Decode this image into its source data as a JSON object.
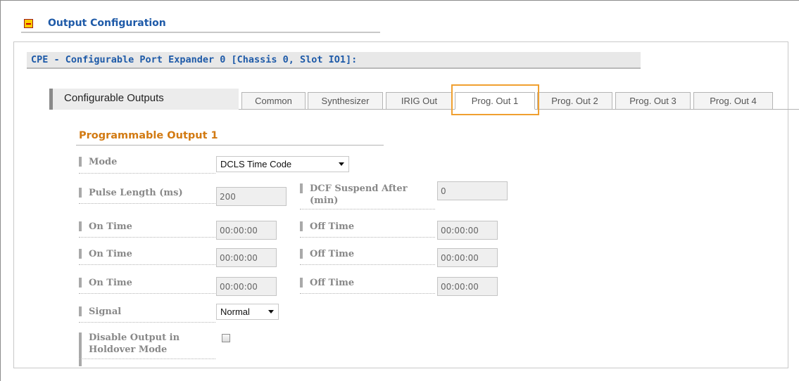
{
  "section": {
    "title": "Output Configuration"
  },
  "panel": {
    "title": "CPE - Configurable Port Expander 0 [Chassis 0, Slot IO1]:"
  },
  "tabs": {
    "heading": "Configurable Outputs",
    "items": [
      {
        "label": "Common"
      },
      {
        "label": "Synthesizer"
      },
      {
        "label": "IRIG Out"
      },
      {
        "label": "Prog. Out 1"
      },
      {
        "label": "Prog. Out 2"
      },
      {
        "label": "Prog. Out 3"
      },
      {
        "label": "Prog. Out 4"
      }
    ],
    "active": "Prog. Out 1"
  },
  "form": {
    "title": "Programmable Output 1",
    "mode": {
      "label": "Mode",
      "value": "DCLS Time Code"
    },
    "pulse_length": {
      "label": "Pulse Length (ms)",
      "value": "200"
    },
    "dcf_suspend": {
      "label_line1": "DCF Suspend After",
      "label_line2": "(min)",
      "value": "0"
    },
    "times": [
      {
        "on_label": "On Time",
        "on_value": "00:00:00",
        "off_label": "Off Time",
        "off_value": "00:00:00"
      },
      {
        "on_label": "On Time",
        "on_value": "00:00:00",
        "off_label": "Off Time",
        "off_value": "00:00:00"
      },
      {
        "on_label": "On Time",
        "on_value": "00:00:00",
        "off_label": "Off Time",
        "off_value": "00:00:00"
      }
    ],
    "signal": {
      "label": "Signal",
      "value": "Normal"
    },
    "disable_holdover": {
      "label_line1": "Disable Output in",
      "label_line2": "Holdover Mode",
      "checked": false
    }
  },
  "colors": {
    "title_blue": "#1e5aa8",
    "form_title_orange": "#d27a12",
    "active_tab_highlight": "#f0a030"
  },
  "icons": {
    "collapse": "minus-square-icon",
    "dropdown": "caret-down-icon"
  }
}
